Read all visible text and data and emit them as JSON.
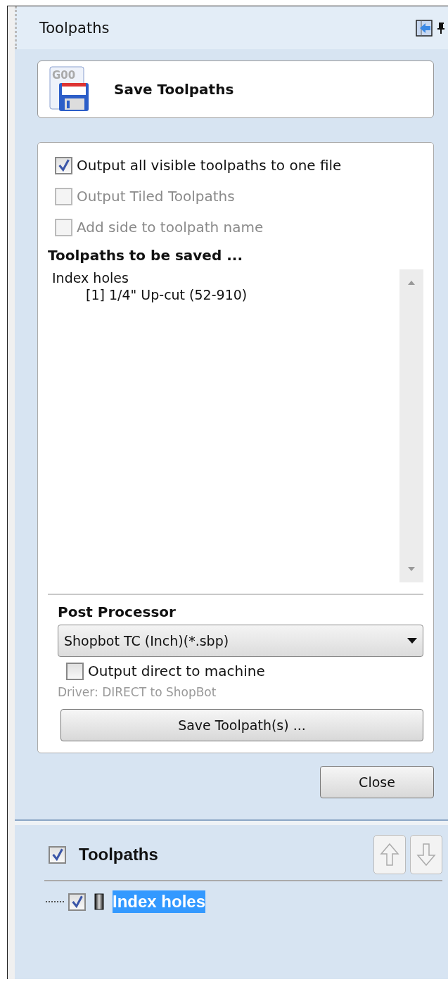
{
  "panel": {
    "title": "Toolpaths"
  },
  "header_button": {
    "icon_text": "G00",
    "label": "Save Toolpaths"
  },
  "options": [
    {
      "label": "Output all visible toolpaths to one file",
      "checked": true,
      "disabled": false
    },
    {
      "label": "Output Tiled Toolpaths",
      "checked": false,
      "disabled": true
    },
    {
      "label": "Add side to toolpath name",
      "checked": false,
      "disabled": true
    }
  ],
  "saved_list": {
    "heading": "Toolpaths to be saved ...",
    "items": [
      {
        "label": "Index holes",
        "children": [
          {
            "label": "[1] 1/4\" Up-cut (52-910)"
          }
        ]
      }
    ]
  },
  "post_processor": {
    "heading": "Post Processor",
    "value": "Shopbot TC (Inch)(*.sbp)"
  },
  "direct_output": {
    "label": "Output direct to machine",
    "checked": false
  },
  "driver": "Driver: DIRECT to ShopBot",
  "save_button": "Save Toolpath(s) ...",
  "close_button": "Close",
  "toolpath_tree": {
    "label": "Toolpaths",
    "checked": true,
    "items": [
      {
        "label": "Index holes",
        "checked": true,
        "selected": true
      }
    ]
  }
}
